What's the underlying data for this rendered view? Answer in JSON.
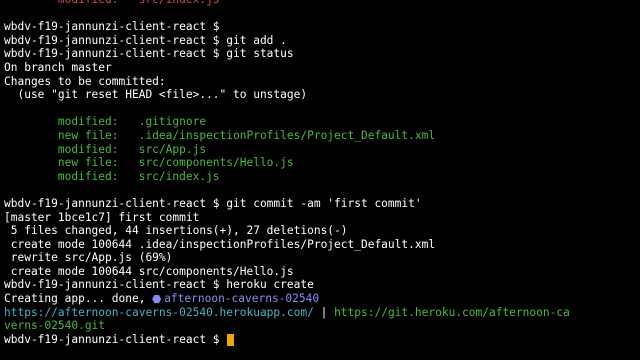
{
  "terminal": {
    "prompt": "wbdv-f19-jannunzi-client-react $",
    "lines": [
      {
        "segs": [
          {
            "text": "        modified:   src/index.js",
            "color": "red"
          }
        ]
      },
      {
        "segs": [
          {
            "text": "",
            "color": "white"
          }
        ]
      },
      {
        "segs": [
          {
            "text": "wbdv-f19-jannunzi-client-react $",
            "color": "white"
          }
        ]
      },
      {
        "segs": [
          {
            "text": "wbdv-f19-jannunzi-client-react $ git add .",
            "color": "white"
          }
        ]
      },
      {
        "segs": [
          {
            "text": "wbdv-f19-jannunzi-client-react $ git status",
            "color": "white"
          }
        ]
      },
      {
        "segs": [
          {
            "text": "On branch master",
            "color": "white"
          }
        ]
      },
      {
        "segs": [
          {
            "text": "Changes to be committed:",
            "color": "white"
          }
        ]
      },
      {
        "segs": [
          {
            "text": "  (use \"git reset HEAD <file>...\" to unstage)",
            "color": "white"
          }
        ]
      },
      {
        "segs": [
          {
            "text": "",
            "color": "white"
          }
        ]
      },
      {
        "segs": [
          {
            "text": "        modified:   .gitignore",
            "color": "green"
          }
        ]
      },
      {
        "segs": [
          {
            "text": "        new file:   .idea/inspectionProfiles/Project_Default.xml",
            "color": "green"
          }
        ]
      },
      {
        "segs": [
          {
            "text": "        modified:   src/App.js",
            "color": "green"
          }
        ]
      },
      {
        "segs": [
          {
            "text": "        new file:   src/components/Hello.js",
            "color": "green"
          }
        ]
      },
      {
        "segs": [
          {
            "text": "        modified:   src/index.js",
            "color": "green"
          }
        ]
      },
      {
        "segs": [
          {
            "text": "",
            "color": "white"
          }
        ]
      },
      {
        "segs": [
          {
            "text": "wbdv-f19-jannunzi-client-react $ git commit -am 'first commit'",
            "color": "white"
          }
        ]
      },
      {
        "segs": [
          {
            "text": "[master 1bce1c7] first commit",
            "color": "white"
          }
        ]
      },
      {
        "segs": [
          {
            "text": " 5 files changed, 44 insertions(+), 27 deletions(-)",
            "color": "white"
          }
        ]
      },
      {
        "segs": [
          {
            "text": " create mode 100644 .idea/inspectionProfiles/Project_Default.xml",
            "color": "white"
          }
        ]
      },
      {
        "segs": [
          {
            "text": " rewrite src/App.js (69%)",
            "color": "white"
          }
        ]
      },
      {
        "segs": [
          {
            "text": " create mode 100644 src/components/Hello.js",
            "color": "white"
          }
        ]
      },
      {
        "segs": [
          {
            "text": "wbdv-f19-jannunzi-client-react $ heroku create",
            "color": "white"
          }
        ]
      },
      {
        "segs": [
          {
            "text": "Creating app... done, ",
            "color": "white"
          },
          {
            "icon": "heroku-hexagon-icon",
            "color": "purple"
          },
          {
            "text": "afternoon-caverns-02540",
            "color": "purple"
          }
        ]
      },
      {
        "segs": [
          {
            "text": "https://afternoon-caverns-02540.herokuapp.com/",
            "color": "cyan"
          },
          {
            "text": " | ",
            "color": "white"
          },
          {
            "text": "https://git.heroku.com/afternoon-ca",
            "color": "green"
          }
        ]
      },
      {
        "segs": [
          {
            "text": "verns-02540.git",
            "color": "green"
          }
        ]
      },
      {
        "segs": [
          {
            "text": "wbdv-f19-jannunzi-client-react $ ",
            "color": "white"
          },
          {
            "cursor": true
          }
        ]
      }
    ]
  },
  "colors": {
    "background": "#000000",
    "text": "#ffffff",
    "modified_unstaged": "#d34a4a",
    "staged": "#4ab93d",
    "url": "#45b2c6",
    "app_name": "#8a8cf2",
    "cursor": "#f5a500"
  }
}
